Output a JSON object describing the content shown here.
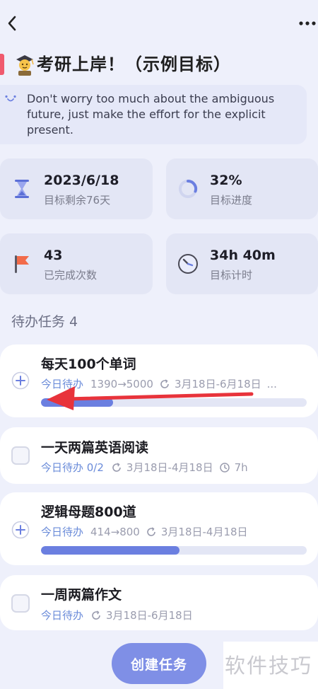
{
  "header": {
    "back_icon": "chevron-left-icon",
    "more_icon": "more-horizontal-icon"
  },
  "goal": {
    "emoji": "student-emoji-icon",
    "title": "考研上岸！（示例目标）",
    "accent_color": "#f05a6e",
    "motto": "Don't worry too much about the ambiguous future, just make the effort for the explicit present."
  },
  "stats": [
    {
      "icon": "hourglass-icon",
      "value": "2023/6/18",
      "label": "目标剩余76天"
    },
    {
      "icon": "progress-ring-icon",
      "value": "32%",
      "label": "目标进度",
      "progress": 0.32
    },
    {
      "icon": "flag-icon",
      "value": "43",
      "label": "已完成次数"
    },
    {
      "icon": "clock-icon",
      "value": "34h 40m",
      "label": "目标计时"
    }
  ],
  "tasks_section": {
    "title": "待办任务",
    "count": "4"
  },
  "tasks": [
    {
      "name": "每天100个单词",
      "today": "今日待办",
      "amount": "1390→5000",
      "date_range": "3月18日-6月18日",
      "extra": "...",
      "progress": 0.27,
      "control": "plus"
    },
    {
      "name": "一天两篇英语阅读",
      "today": "今日待办 0/2",
      "date_range": "3月18日-4月18日",
      "duration": "7h",
      "control": "checkbox"
    },
    {
      "name": "逻辑母题800道",
      "today": "今日待办",
      "amount": "414→800",
      "date_range": "3月18日-4月18日",
      "progress": 0.52,
      "control": "plus"
    },
    {
      "name": "一周两篇作文",
      "today": "今日待办",
      "date_range": "3月18日-6月18日",
      "control": "checkbox"
    }
  ],
  "actions": {
    "create_task": "创建任务"
  },
  "watermark": "软件技巧",
  "colors": {
    "accent": "#6b7fe0",
    "button": "#7f8fe6",
    "annotation_arrow": "#e8333b"
  }
}
